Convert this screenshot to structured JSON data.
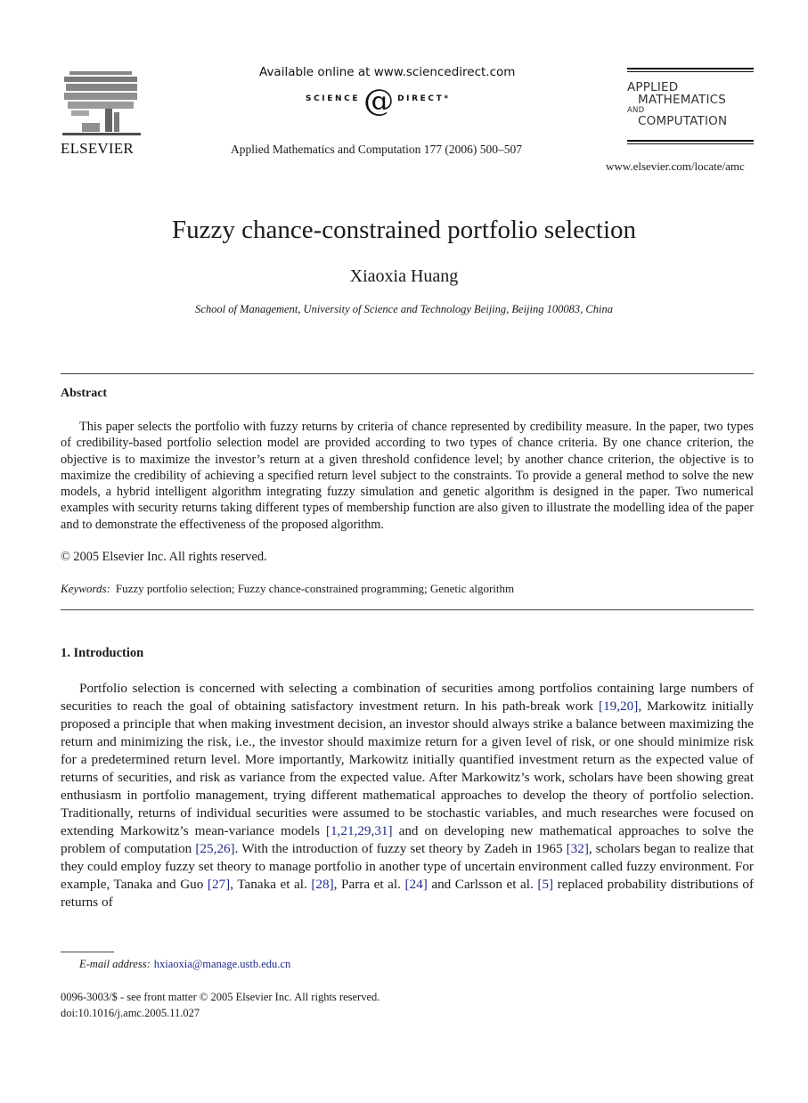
{
  "header": {
    "publisher_logo_text": "ELSEVIER",
    "sciencedirect_available": "Available online at www.sciencedirect.com",
    "sciencedirect_logo_left": "SCIENCE",
    "sciencedirect_logo_at": "@",
    "sciencedirect_logo_right": "DIRECT*",
    "journal_reference": "Applied Mathematics and Computation 177 (2006) 500–507",
    "journal_logo_lines": [
      "APPLIED",
      "MATHEMATICS",
      "AND",
      "COMPUTATION"
    ],
    "journal_url": "www.elsevier.com/locate/amc"
  },
  "article": {
    "title": "Fuzzy chance-constrained portfolio selection",
    "author": "Xiaoxia Huang",
    "affiliation": "School of Management, University of Science and Technology Beijing, Beijing 100083, China"
  },
  "abstract": {
    "heading": "Abstract",
    "text": "This paper selects the portfolio with fuzzy returns by criteria of chance represented by credibility measure. In the paper, two types of credibility-based portfolio selection model are provided according to two types of chance criteria. By one chance criterion, the objective is to maximize the investor’s return at a given threshold confidence level; by another chance criterion, the objective is to maximize the credibility of achieving a specified return level subject to the constraints. To provide a general method to solve the new models, a hybrid intelligent algorithm integrating fuzzy simulation and genetic algorithm is designed in the paper. Two numerical examples with security returns taking different types of membership function are also given to illustrate the modelling idea of the paper and to demonstrate the effectiveness of the proposed algorithm.",
    "copyright": "© 2005 Elsevier Inc. All rights reserved.",
    "keywords_label": "Keywords:",
    "keywords": "Fuzzy portfolio selection; Fuzzy chance-constrained programming; Genetic algorithm"
  },
  "introduction": {
    "heading": "1. Introduction",
    "segments": [
      {
        "t": "Portfolio selection is concerned with selecting a combination of securities among portfolios containing large numbers of securities to reach the goal of obtaining satisfactory investment return. In his path-break work "
      },
      {
        "t": "[19,20]",
        "ref": true
      },
      {
        "t": ", Markowitz initially proposed a principle that when making investment decision, an investor should always strike a balance between maximizing the return and minimizing the risk, i.e., the investor should maximize return for a given level of risk, or one should minimize risk for a predetermined return level. More importantly, Markowitz initially quantified investment return as the expected value of returns of securities, and risk as variance from the expected value. After Markowitz’s work, scholars have been showing great enthusiasm in portfolio management, trying different mathematical approaches to develop the theory of portfolio selection. Traditionally, returns of individual securities were assumed to be stochastic variables, and much researches were focused on extending Markowitz’s mean-variance models "
      },
      {
        "t": "[1,21,29,31]",
        "ref": true
      },
      {
        "t": " and on developing new mathematical approaches to solve the problem of computation "
      },
      {
        "t": "[25,26]",
        "ref": true
      },
      {
        "t": ". With the introduction of fuzzy set theory by Zadeh in 1965 "
      },
      {
        "t": "[32]",
        "ref": true
      },
      {
        "t": ", scholars began to realize that they could employ fuzzy set theory to manage portfolio in another type of uncertain environment called fuzzy environment. For example, Tanaka and Guo "
      },
      {
        "t": "[27]",
        "ref": true
      },
      {
        "t": ", Tanaka et al. "
      },
      {
        "t": "[28]",
        "ref": true
      },
      {
        "t": ", Parra et al. "
      },
      {
        "t": "[24]",
        "ref": true
      },
      {
        "t": " and Carlsson et al. "
      },
      {
        "t": "[5]",
        "ref": true
      },
      {
        "t": " replaced probability distributions of returns of"
      }
    ]
  },
  "footnote": {
    "label": "E-mail address:",
    "email": "hxiaoxia@manage.ustb.edu.cn"
  },
  "front_matter": {
    "issn_line": "0096-3003/$ - see front matter  © 2005 Elsevier Inc. All rights reserved.",
    "doi": "doi:10.1016/j.amc.2005.11.027"
  },
  "colors": {
    "text": "#1a1a1a",
    "link": "#1f2a8a"
  }
}
